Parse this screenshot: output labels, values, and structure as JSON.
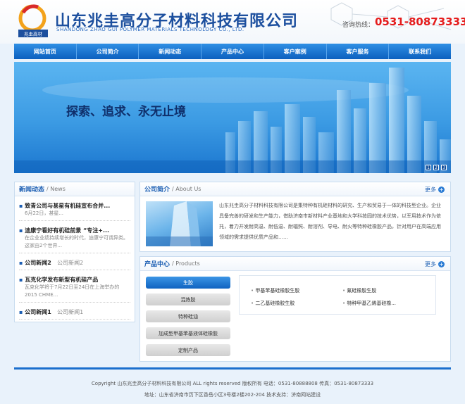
{
  "header": {
    "company_cn": "山东兆圭高分子材料科技有限公司",
    "company_en": "SHANDONG ZHAO GUI POLYMER MATERIALS TECHNOLOGY CO., LTD.",
    "logo_text": "兆圭高材",
    "hotline_label": "咨询热线：",
    "hotline_number": "0531-80873333"
  },
  "nav": {
    "items": [
      "网站首页",
      "公司简介",
      "新闻动态",
      "产品中心",
      "客户案例",
      "客户服务",
      "联系我们"
    ]
  },
  "banner": {
    "slogan": "探索、追求、永无止境",
    "pages": [
      "1",
      "2",
      "3"
    ]
  },
  "news": {
    "title_cn": "新闻动态",
    "title_en": "/ News",
    "items": [
      {
        "title": "致青公司与甚星有机硅宣布合并...",
        "sub": "6月22日，甚星..."
      },
      {
        "title": "迪康宁看好有机硅前景 “专注+...",
        "sub": "在企业业绩持续增长的时代，迪康宁可谓异类。这家由2个世界..."
      },
      {
        "title": "公司新闻2",
        "meta": "公司新闻2",
        "sub": ""
      },
      {
        "title": "瓦克化学发布新型有机硅产品",
        "sub": "瓦克化学将于7月22日至24日在上海举办的2015 CHME..."
      },
      {
        "title": "公司新闻1",
        "meta": "公司新闻1",
        "sub": ""
      }
    ]
  },
  "about": {
    "title_cn": "公司简介",
    "title_en": "/ About Us",
    "more": "更多",
    "text": "山东兆圭高分子材料科技有限公司是集特种有机硅材料的研究、生产和贸易于一体的科技型企业。企业具备完善的研发和生产能力，借助济南市新材料产业基地和大学科技园的技术优势，以军用技术作为依托，着力开发耐高温、耐低温、耐辐照、耐溶剂、导电、耐火等特种硅橡胶产品，针对用户在高端应用领域的需求提供优质产品和……"
  },
  "products": {
    "title_cn": "产品中心",
    "title_en": "/ Products",
    "more": "更多",
    "categories": [
      "生胶",
      "混炼胶",
      "特种硅油",
      "加成型甲基苯基液体硅橡胶",
      "定制产品"
    ],
    "items": [
      "甲基苯基硅橡胶生胶",
      "氟硅橡胶生胶",
      "二乙基硅橡胶生胶",
      "特种甲基乙烯基硅橡..."
    ]
  },
  "footer": {
    "copyright": "Copyright 山东兆圭高分子材料科技有限公司 ALL rights reserved 版权所有 电话：0531-80888808 传真：0531-80873333",
    "address": "地址：山东省济南市历下区香岳小区3号楼2楼202-204 技术支持：济南网站建设"
  },
  "colors": {
    "nav": "#1473d3",
    "hotline": "#e51c1c",
    "title": "#1c4f9e"
  }
}
